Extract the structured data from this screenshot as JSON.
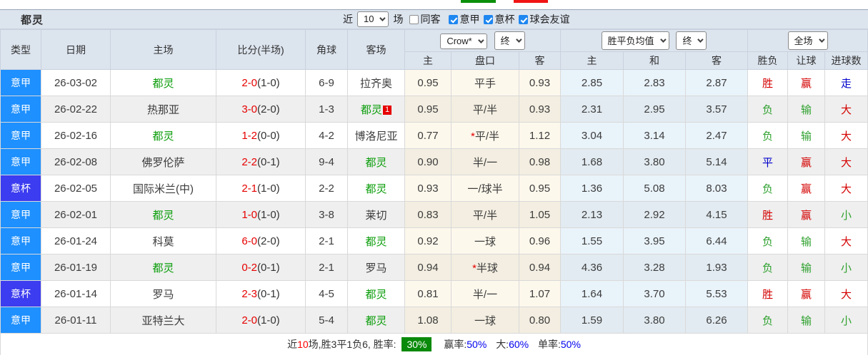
{
  "top": {
    "team_title": "都灵",
    "filter": {
      "recent_label": "近",
      "recent_value": "10",
      "unit_label": "场",
      "checkboxes": [
        {
          "label": "同客",
          "checked": false
        },
        {
          "label": "意甲",
          "checked": true
        },
        {
          "label": "意杯",
          "checked": true
        },
        {
          "label": "球会友谊",
          "checked": true
        }
      ]
    }
  },
  "header": {
    "static_cols": [
      "类型",
      "日期",
      "主场",
      "比分(半场)",
      "角球",
      "客场"
    ],
    "odds_group": {
      "bookmaker_select": "Crow*",
      "state_select": "终",
      "subcols": [
        "主",
        "盘口",
        "客"
      ]
    },
    "avg_group": {
      "metric_select": "胜平负均值",
      "state_select": "终",
      "subcols": [
        "主",
        "和",
        "客"
      ]
    },
    "result_group": {
      "scope_select": "全场",
      "subcols": [
        "胜负",
        "让球",
        "进球数"
      ]
    }
  },
  "colors": {
    "serie_a_blue": "#1e90ff",
    "cup_blue": "#3c3cf0",
    "team_green": "#0a9d0a",
    "score_red": "#e60000",
    "win_red": "#d40000",
    "lose_green": "#2ea12e",
    "draw_blue": "#0000cc",
    "rate_badge_green": "#0a8a0a"
  },
  "rows": [
    {
      "type": "意甲",
      "type_class": "serie-a",
      "date": "26-03-02",
      "home": "都灵",
      "home_green": true,
      "score_ft": "2-0",
      "score_ht": "(1-0)",
      "corners": "6-9",
      "away": "拉齐奥",
      "away_green": false,
      "away_badge": "",
      "odds_home": "0.95",
      "handicap_prefix": "",
      "handicap": "平手",
      "odds_away": "0.93",
      "avg_home": "2.85",
      "avg_draw": "2.83",
      "avg_away": "2.87",
      "wdl": "胜",
      "wdl_c": "r",
      "hcp_result": "赢",
      "hcp_c": "r",
      "goal": "走",
      "goal_c": "b"
    },
    {
      "type": "意甲",
      "type_class": "serie-a",
      "date": "26-02-22",
      "home": "热那亚",
      "home_green": false,
      "score_ft": "3-0",
      "score_ht": "(2-0)",
      "corners": "1-3",
      "away": "都灵",
      "away_green": true,
      "away_badge": "1",
      "odds_home": "0.95",
      "handicap_prefix": "",
      "handicap": "平/半",
      "odds_away": "0.93",
      "avg_home": "2.31",
      "avg_draw": "2.95",
      "avg_away": "3.57",
      "wdl": "负",
      "wdl_c": "g",
      "hcp_result": "输",
      "hcp_c": "g",
      "goal": "大",
      "goal_c": "r"
    },
    {
      "type": "意甲",
      "type_class": "serie-a",
      "date": "26-02-16",
      "home": "都灵",
      "home_green": true,
      "score_ft": "1-2",
      "score_ht": "(0-0)",
      "corners": "4-2",
      "away": "博洛尼亚",
      "away_green": false,
      "away_badge": "",
      "odds_home": "0.77",
      "handicap_prefix": "*",
      "handicap": "平/半",
      "odds_away": "1.12",
      "avg_home": "3.04",
      "avg_draw": "3.14",
      "avg_away": "2.47",
      "wdl": "负",
      "wdl_c": "g",
      "hcp_result": "输",
      "hcp_c": "g",
      "goal": "大",
      "goal_c": "r"
    },
    {
      "type": "意甲",
      "type_class": "serie-a",
      "date": "26-02-08",
      "home": "佛罗伦萨",
      "home_green": false,
      "score_ft": "2-2",
      "score_ht": "(0-1)",
      "corners": "9-4",
      "away": "都灵",
      "away_green": true,
      "away_badge": "",
      "odds_home": "0.90",
      "handicap_prefix": "",
      "handicap": "半/一",
      "odds_away": "0.98",
      "avg_home": "1.68",
      "avg_draw": "3.80",
      "avg_away": "5.14",
      "wdl": "平",
      "wdl_c": "b",
      "hcp_result": "赢",
      "hcp_c": "r",
      "goal": "大",
      "goal_c": "r"
    },
    {
      "type": "意杯",
      "type_class": "cup",
      "date": "26-02-05",
      "home": "国际米兰(中)",
      "home_green": false,
      "score_ft": "2-1",
      "score_ht": "(1-0)",
      "corners": "2-2",
      "away": "都灵",
      "away_green": true,
      "away_badge": "",
      "odds_home": "0.93",
      "handicap_prefix": "",
      "handicap": "一/球半",
      "odds_away": "0.95",
      "avg_home": "1.36",
      "avg_draw": "5.08",
      "avg_away": "8.03",
      "wdl": "负",
      "wdl_c": "g",
      "hcp_result": "赢",
      "hcp_c": "r",
      "goal": "大",
      "goal_c": "r"
    },
    {
      "type": "意甲",
      "type_class": "serie-a",
      "date": "26-02-01",
      "home": "都灵",
      "home_green": true,
      "score_ft": "1-0",
      "score_ht": "(1-0)",
      "corners": "3-8",
      "away": "莱切",
      "away_green": false,
      "away_badge": "",
      "odds_home": "0.83",
      "handicap_prefix": "",
      "handicap": "平/半",
      "odds_away": "1.05",
      "avg_home": "2.13",
      "avg_draw": "2.92",
      "avg_away": "4.15",
      "wdl": "胜",
      "wdl_c": "r",
      "hcp_result": "赢",
      "hcp_c": "r",
      "goal": "小",
      "goal_c": "g"
    },
    {
      "type": "意甲",
      "type_class": "serie-a",
      "date": "26-01-24",
      "home": "科莫",
      "home_green": false,
      "score_ft": "6-0",
      "score_ht": "(2-0)",
      "corners": "2-1",
      "away": "都灵",
      "away_green": true,
      "away_badge": "",
      "odds_home": "0.92",
      "handicap_prefix": "",
      "handicap": "一球",
      "odds_away": "0.96",
      "avg_home": "1.55",
      "avg_draw": "3.95",
      "avg_away": "6.44",
      "wdl": "负",
      "wdl_c": "g",
      "hcp_result": "输",
      "hcp_c": "g",
      "goal": "大",
      "goal_c": "r"
    },
    {
      "type": "意甲",
      "type_class": "serie-a",
      "date": "26-01-19",
      "home": "都灵",
      "home_green": true,
      "score_ft": "0-2",
      "score_ht": "(0-1)",
      "corners": "2-1",
      "away": "罗马",
      "away_green": false,
      "away_badge": "",
      "odds_home": "0.94",
      "handicap_prefix": "*",
      "handicap": "半球",
      "odds_away": "0.94",
      "avg_home": "4.36",
      "avg_draw": "3.28",
      "avg_away": "1.93",
      "wdl": "负",
      "wdl_c": "g",
      "hcp_result": "输",
      "hcp_c": "g",
      "goal": "小",
      "goal_c": "g"
    },
    {
      "type": "意杯",
      "type_class": "cup",
      "date": "26-01-14",
      "home": "罗马",
      "home_green": false,
      "score_ft": "2-3",
      "score_ht": "(0-1)",
      "corners": "4-5",
      "away": "都灵",
      "away_green": true,
      "away_badge": "",
      "odds_home": "0.81",
      "handicap_prefix": "",
      "handicap": "半/一",
      "odds_away": "1.07",
      "avg_home": "1.64",
      "avg_draw": "3.70",
      "avg_away": "5.53",
      "wdl": "胜",
      "wdl_c": "r",
      "hcp_result": "赢",
      "hcp_c": "r",
      "goal": "大",
      "goal_c": "r"
    },
    {
      "type": "意甲",
      "type_class": "serie-a",
      "date": "26-01-11",
      "home": "亚特兰大",
      "home_green": false,
      "score_ft": "2-0",
      "score_ht": "(1-0)",
      "corners": "5-4",
      "away": "都灵",
      "away_green": true,
      "away_badge": "",
      "odds_home": "1.08",
      "handicap_prefix": "",
      "handicap": "一球",
      "odds_away": "0.80",
      "avg_home": "1.59",
      "avg_draw": "3.80",
      "avg_away": "6.26",
      "wdl": "负",
      "wdl_c": "g",
      "hcp_result": "输",
      "hcp_c": "g",
      "goal": "小",
      "goal_c": "g"
    }
  ],
  "summary": {
    "recent_label": "近",
    "recent_count": "10",
    "body": "场,胜3平1负6, 胜率:",
    "win_rate": "30%",
    "stats": [
      {
        "label": "赢率:",
        "value": "50%"
      },
      {
        "label": "大:",
        "value": "60%"
      },
      {
        "label": "单率:",
        "value": "50%"
      }
    ]
  }
}
